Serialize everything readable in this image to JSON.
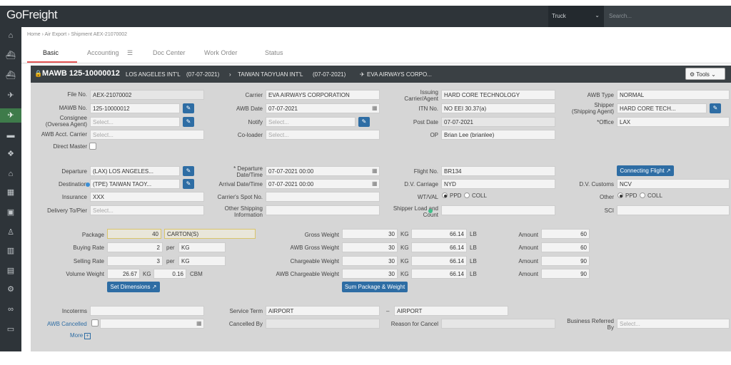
{
  "app": {
    "logo": "GoFreight",
    "mode_select": "Truck",
    "search_placeholder": "Search..."
  },
  "sidebar_icons": [
    "home-icon",
    "ship-icon",
    "ship-in-icon",
    "plane-out-icon",
    "plane-in-icon",
    "truck-icon",
    "boxes-icon",
    "warehouse-icon",
    "calculator-icon",
    "briefcase-icon",
    "user-icon",
    "chart-icon",
    "document-icon",
    "gear-icon",
    "link-icon",
    "archive-icon"
  ],
  "breadcrumb": "Home  ›  Air Export  ›  Shipment AEX-21070002",
  "tabs": [
    "Basic",
    "Accounting",
    "Doc Center",
    "Work Order",
    "Status"
  ],
  "header": {
    "title": "MAWB 125-10000012",
    "origin": "LOS ANGELES INT'L",
    "origin_date": "(07-07-2021)",
    "arrow": "›",
    "dest": "TAIWAN TAOYUAN INT'L",
    "dest_date": "(07-07-2021)",
    "carrier": "EVA AIRWAYS CORPO...",
    "tools": "Tools"
  },
  "col1": {
    "file_no_label": "File No.",
    "file_no": "AEX-21070002",
    "mawb_label": "MAWB No.",
    "mawb": "125-10000012",
    "consignee_label": "Consignee\n(Oversea Agent)",
    "consignee_ph": "Select...",
    "awb_acct_label": "AWB Acct. Carrier",
    "awb_acct_ph": "Select...",
    "direct_master_label": "Direct Master",
    "departure_label": "Departure",
    "departure": "(LAX) LOS ANGELES...",
    "destination_label": "Destination",
    "destination": "(TPE) TAIWAN TAOY...",
    "insurance_label": "Insurance",
    "insurance": "XXX",
    "delivery_label": "Delivery To/Pier",
    "delivery_ph": "Select..."
  },
  "col2": {
    "carrier_label": "Carrier",
    "carrier": "EVA AIRWAYS CORPORATION",
    "awb_date_label": "AWB Date",
    "awb_date": "07-07-2021",
    "notify_label": "Notify",
    "notify_ph": "Select...",
    "coloader_label": "Co-loader",
    "coloader_ph": "Select...",
    "departure_dt_label": "* Departure\nDate/Time",
    "departure_dt": "07-07-2021 00:00",
    "arrival_dt_label": "Arrival Date/Time",
    "arrival_dt": "07-07-2021 00:00",
    "spot_label": "Carrier's Spot No.",
    "other_shipping_label": "Other Shipping\nInformation"
  },
  "col3": {
    "issuing_label": "Issuing\nCarrier/Agent",
    "issuing": "HARD CORE TECHNOLOGY",
    "itn_label": "ITN No.",
    "itn": "NO EEI 30.37(a)",
    "post_date_label": "Post Date",
    "post_date": "07-07-2021",
    "op_label": "OP",
    "op": "Brian Lee (brianlee)",
    "flight_label": "Flight No.",
    "flight": "BR134",
    "dv_carriage_label": "D.V. Carriage",
    "dv_carriage": "NYD",
    "wtval_label": "WT/VAL",
    "ppd": "PPD",
    "coll": "COLL",
    "shipper_load_label": "Shipper Load and\nCount"
  },
  "col4": {
    "awb_type_label": "AWB Type",
    "awb_type": "NORMAL",
    "shipper_label": "Shipper\n(Shipping Agent)",
    "shipper": "HARD CORE TECH...",
    "office_label": "*Office",
    "office": "LAX",
    "connecting_flight": "Connecting Flight",
    "dv_customs_label": "D.V. Customs",
    "dv_customs": "NCV",
    "other_label": "Other",
    "ppd": "PPD",
    "coll": "COLL",
    "sci_label": "SCI"
  },
  "cargo": {
    "package_label": "Package",
    "package": "40",
    "package_unit": "CARTON(S)",
    "buying_label": "Buying Rate",
    "buying": "2",
    "buying_per": "per",
    "buying_unit": "KG",
    "selling_label": "Selling Rate",
    "selling": "3",
    "selling_per": "per",
    "selling_unit": "KG",
    "volume_label": "Volume Weight",
    "volume_kg": "26.67",
    "kg": "KG",
    "volume_cbm": "0.16",
    "cbm": "CBM",
    "set_dimensions": "Set Dimensions",
    "gross_label": "Gross Weight",
    "gross_kg": "30",
    "gross_lb": "66.14",
    "awb_gross_label": "AWB Gross Weight",
    "awb_gross_kg": "30",
    "awb_gross_lb": "66.14",
    "chargeable_label": "Chargeable Weight",
    "chargeable_kg": "30",
    "chargeable_lb": "66.14",
    "awb_chargeable_label": "AWB Chargeable Weight",
    "awb_chargeable_kg": "30",
    "awb_chargeable_lb": "66.14",
    "kg_unit": "KG",
    "lb_unit": "LB",
    "sum_button": "Sum Package & Weight",
    "amount_label": "Amount",
    "amounts": [
      "60",
      "60",
      "90",
      "90"
    ]
  },
  "footer": {
    "incoterms_label": "Incoterms",
    "service_label": "Service Term",
    "service_from": "AIRPORT",
    "service_to": "AIRPORT",
    "dash": "–",
    "awb_cancelled_label": "AWB Cancelled",
    "cancelled_by_label": "Cancelled By",
    "reason_label": "Reason for Cancel",
    "business_label": "Business Referred\nBy",
    "business_ph": "Select...",
    "more": "More"
  }
}
